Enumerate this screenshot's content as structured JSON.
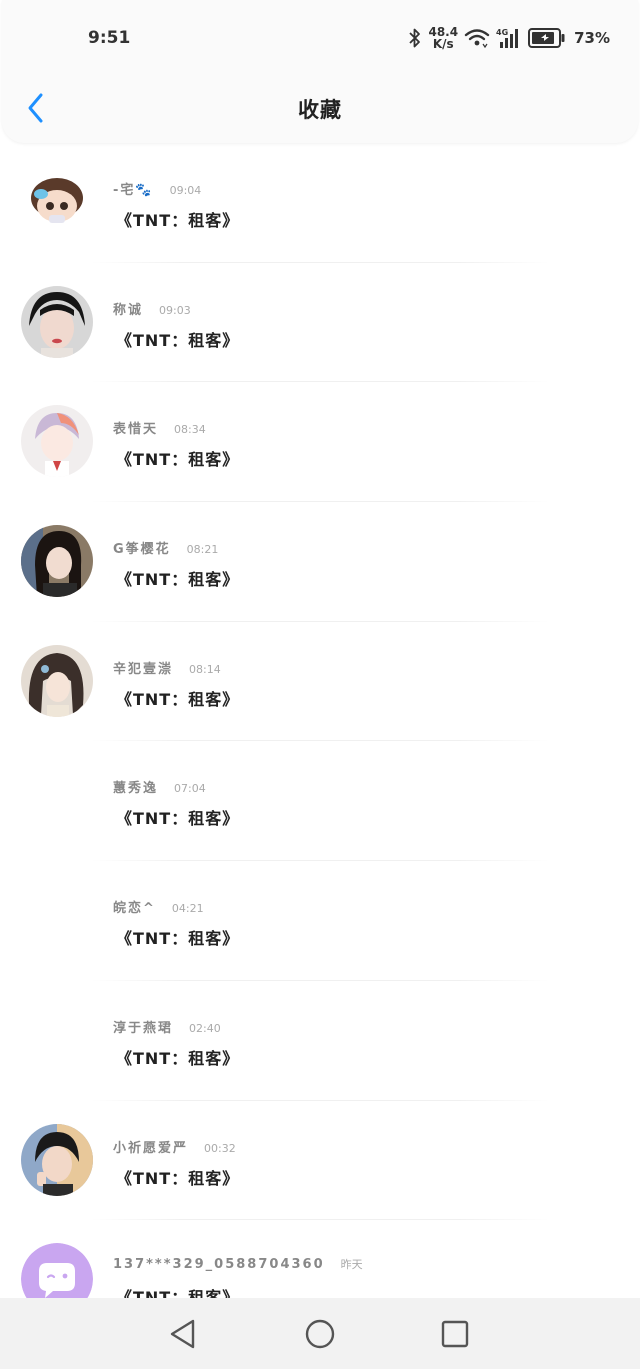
{
  "status_bar": {
    "time": "9:51",
    "net_speed_value": "48.4",
    "net_speed_unit": "K/s",
    "network_type": "4G",
    "battery_percent": "73%"
  },
  "header": {
    "title": "收藏",
    "back_icon": "chevron-left-icon",
    "accent_color": "#1e90ff"
  },
  "items": [
    {
      "name": "-宅🐾",
      "time": "09:04",
      "message": "《TNT：租客》",
      "avatar": "cartoon-boy"
    },
    {
      "name": "称诚",
      "time": "09:03",
      "message": "《TNT：租客》",
      "avatar": "photo"
    },
    {
      "name": "表惜天",
      "time": "08:34",
      "message": "《TNT：租客》",
      "avatar": "anime-boy"
    },
    {
      "name": "G筝樱花",
      "time": "08:21",
      "message": "《TNT：租客》",
      "avatar": "photo-girl"
    },
    {
      "name": "辛犯壹漴",
      "time": "08:14",
      "message": "《TNT：租客》",
      "avatar": "anime-girl"
    },
    {
      "name": "蕙秀逸",
      "time": "07:04",
      "message": "《TNT：租客》",
      "avatar": "none"
    },
    {
      "name": "皖恋^",
      "time": "04:21",
      "message": "《TNT：租客》",
      "avatar": "none"
    },
    {
      "name": "淳于燕珺",
      "time": "02:40",
      "message": "《TNT：租客》",
      "avatar": "none"
    },
    {
      "name": "小祈愿爱严",
      "time": "00:32",
      "message": "《TNT：租客》",
      "avatar": "photo-boy"
    },
    {
      "name": "137***329_0588704360",
      "time": "昨天",
      "message": "《TNT：租客》",
      "avatar": "default-chat"
    }
  ],
  "nav_bar": {
    "back_icon": "triangle-back-icon",
    "home_icon": "circle-home-icon",
    "recent_icon": "square-recents-icon"
  }
}
